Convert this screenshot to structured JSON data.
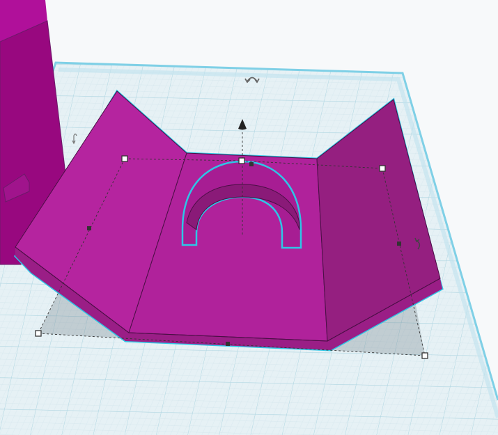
{
  "colors": {
    "background": "#f7f9fa",
    "workplane": "#e6f1f5",
    "grid_minor": "#cfe3ea",
    "grid_major": "#9ccfdd",
    "workplane_edge": "#7fd0e6",
    "shape_light": "#b5249f",
    "shape_mid": "#a51c92",
    "shape_dark": "#8f1b7c",
    "selection_outline": "#2ec6e6",
    "handle": "#333333"
  },
  "scene": {
    "selected_shape": "bracket",
    "other_shape": "box"
  }
}
